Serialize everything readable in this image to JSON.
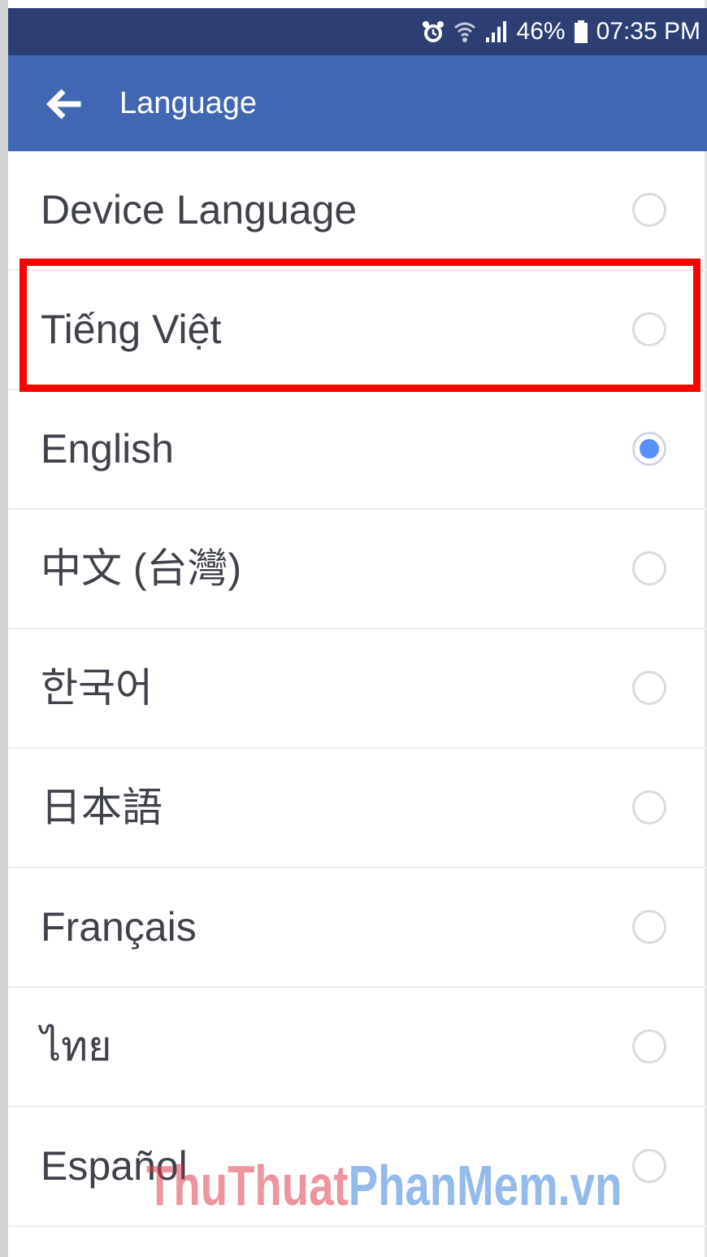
{
  "status_bar": {
    "battery": "46%",
    "time": "07:35 PM",
    "icons": [
      "alarm-icon",
      "wifi-icon",
      "signal-icon",
      "battery-icon"
    ]
  },
  "app_bar": {
    "back_icon": "back-arrow-icon",
    "title": "Language"
  },
  "languages": [
    {
      "label": "Device Language",
      "selected": false
    },
    {
      "label": "Tiếng Việt",
      "selected": false,
      "highlighted": true
    },
    {
      "label": "English",
      "selected": true
    },
    {
      "label": "中文 (台灣)",
      "selected": false
    },
    {
      "label": "한국어",
      "selected": false
    },
    {
      "label": "日本語",
      "selected": false
    },
    {
      "label": "Français",
      "selected": false
    },
    {
      "label": "ไทย",
      "selected": false
    },
    {
      "label": "Español",
      "selected": false
    }
  ],
  "watermark": {
    "part1": "ThuThuat",
    "part2": "PhanMem.vn"
  },
  "colors": {
    "status_bar": "#2c3e72",
    "app_bar": "#4267b2",
    "radio_selected": "#5890ff",
    "highlight_box": "#ff0000"
  }
}
